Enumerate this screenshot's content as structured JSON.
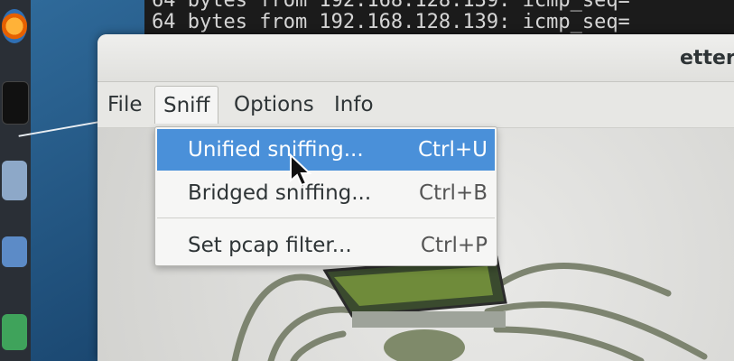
{
  "terminal": {
    "lines": [
      "64 bytes from 192.168.128.139: icmp_seq=",
      "64 bytes from 192.168.128.139: icmp_seq="
    ]
  },
  "window": {
    "title": "ettercap"
  },
  "menubar": {
    "items": [
      {
        "label": "File"
      },
      {
        "label": "Sniff"
      },
      {
        "label": "Options"
      },
      {
        "label": "Info"
      }
    ]
  },
  "sniff_menu": {
    "items": [
      {
        "label": "Unified sniffing...",
        "shortcut": "Ctrl+U"
      },
      {
        "label": "Bridged sniffing...",
        "shortcut": "Ctrl+B"
      },
      {
        "label": "Set pcap filter...",
        "shortcut": "Ctrl+P"
      }
    ]
  },
  "colors": {
    "highlight": "#4a90d9",
    "menu_bg": "#f6f6f5",
    "window_bg": "#d9d9d6"
  }
}
